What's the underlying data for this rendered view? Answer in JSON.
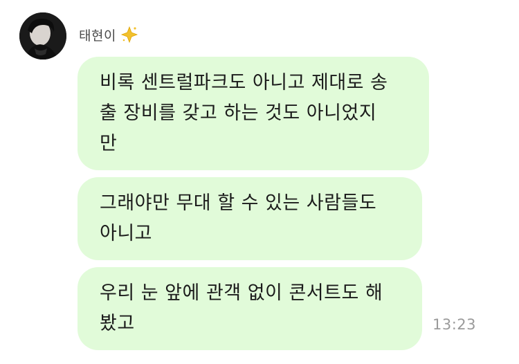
{
  "chat": {
    "sender": {
      "name": "태현이",
      "badge_icon": "sparkle-star-icon",
      "avatar_icon": "profile-photo"
    },
    "messages": [
      {
        "text": "비록 센트럴파크도 아니고 제대로 송\n출 장비를 갖고 하는 것도 아니었지\n만"
      },
      {
        "text": "그래야만 무대 할 수 있는 사람들도\n아니고"
      },
      {
        "text": "우리 눈 앞에 관객 없이 콘서트도 해\n봤고"
      }
    ],
    "timestamp": "13:23",
    "colors": {
      "bubble": "#e1fbd9",
      "text": "#1b1b1b",
      "timestamp": "#9a9a9a"
    }
  }
}
